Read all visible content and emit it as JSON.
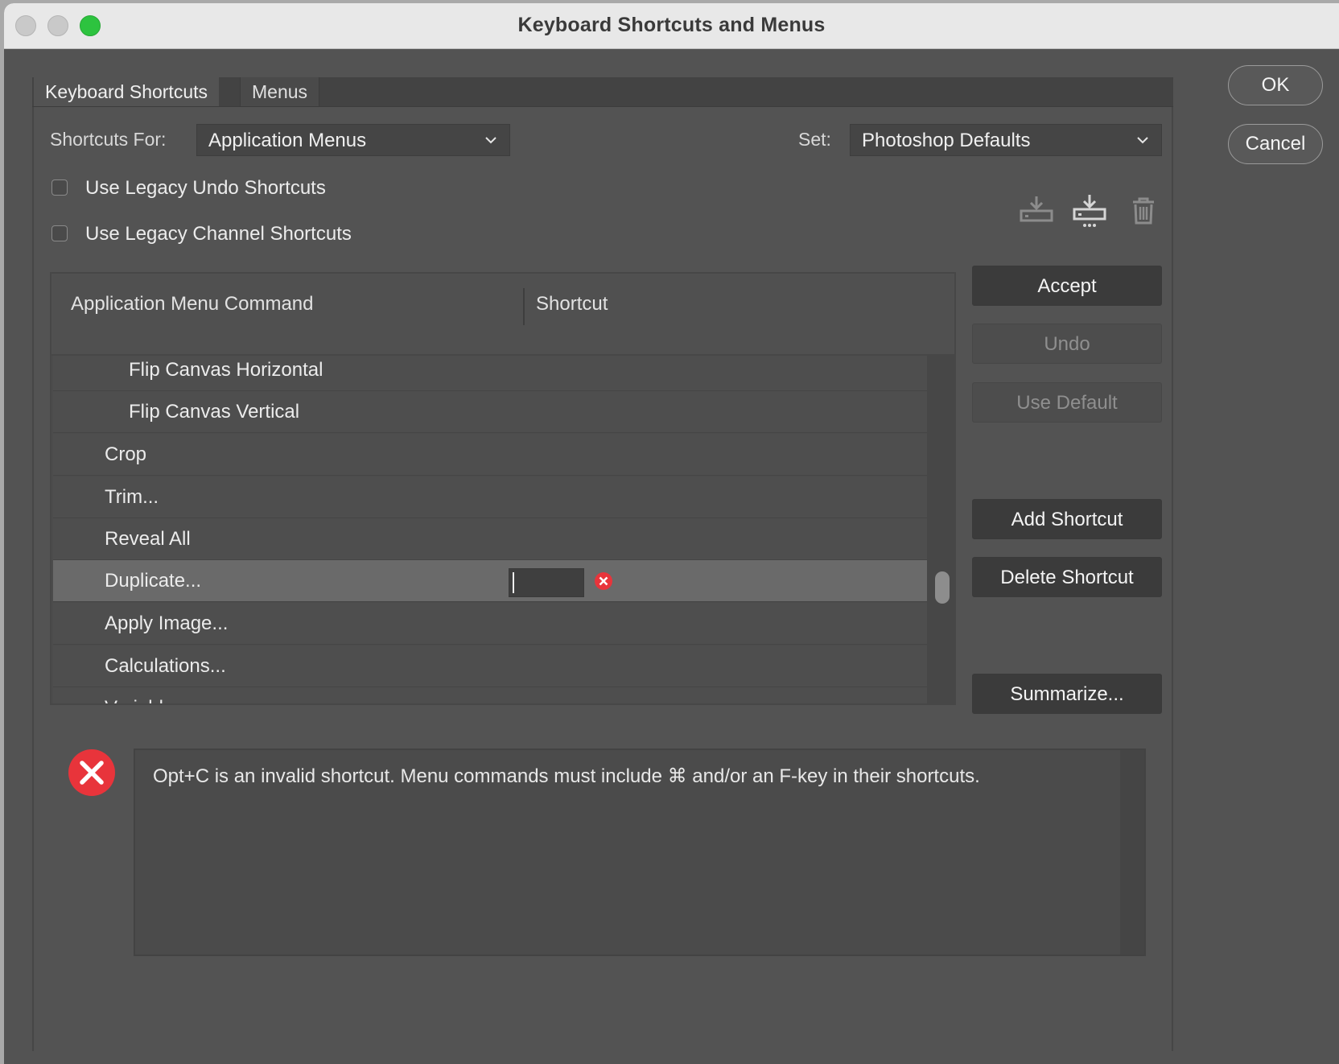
{
  "window": {
    "title": "Keyboard Shortcuts and Menus"
  },
  "tabs": [
    {
      "label": "Keyboard Shortcuts",
      "active": true
    },
    {
      "label": "Menus",
      "active": false
    }
  ],
  "shortcuts_for": {
    "label": "Shortcuts For:",
    "value": "Application Menus"
  },
  "set": {
    "label": "Set:",
    "value": "Photoshop Defaults"
  },
  "options": [
    {
      "label": "Use Legacy Undo Shortcuts",
      "checked": false
    },
    {
      "label": "Use Legacy Channel Shortcuts",
      "checked": false
    }
  ],
  "set_icons": [
    "save-set-icon",
    "save-as-new-set-icon",
    "trash-icon"
  ],
  "table": {
    "headers": {
      "command": "Application Menu Command",
      "shortcut": "Shortcut"
    },
    "rows": [
      {
        "command": "Flip Canvas Horizontal",
        "indent": 2
      },
      {
        "command": "Flip Canvas Vertical",
        "indent": 2
      },
      {
        "command": "Crop",
        "indent": 1
      },
      {
        "command": "Trim...",
        "indent": 1
      },
      {
        "command": "Reveal All",
        "indent": 1
      },
      {
        "command": "Duplicate...",
        "indent": 1,
        "selected": true,
        "shortcut": ""
      },
      {
        "command": "Apply Image...",
        "indent": 1
      },
      {
        "command": "Calculations...",
        "indent": 1
      },
      {
        "command": "Variables...",
        "indent": 1
      }
    ]
  },
  "buttons": {
    "ok": "OK",
    "cancel": "Cancel",
    "accept": "Accept",
    "undo": "Undo",
    "use_default": "Use Default",
    "add_shortcut": "Add Shortcut",
    "delete_shortcut": "Delete Shortcut",
    "summarize": "Summarize..."
  },
  "message": {
    "text": "Opt+C is an invalid shortcut.  Menu commands must include ⌘ and/or an F-key in their shortcuts.",
    "icon": "error-icon"
  },
  "colors": {
    "error": "#e8343b",
    "window_bg": "#535353"
  }
}
